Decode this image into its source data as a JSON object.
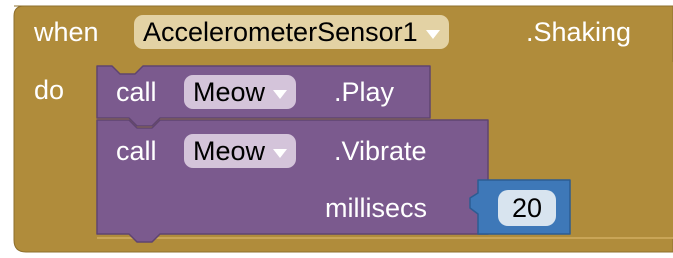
{
  "event_block": {
    "when_label": "when",
    "component": "AccelerometerSensor1",
    "event_name": ".Shaking",
    "do_label": "do",
    "color": "#b08c3b"
  },
  "statements": [
    {
      "call_label": "call",
      "component": "Meow",
      "method": ".Play",
      "color": "#7b5a8e"
    },
    {
      "call_label": "call",
      "component": "Meow",
      "method": ".Vibrate",
      "arg_label": "millisecs",
      "arg_value": "20",
      "color": "#7b5a8e"
    }
  ],
  "number_block": {
    "color": "#3e78b8"
  }
}
